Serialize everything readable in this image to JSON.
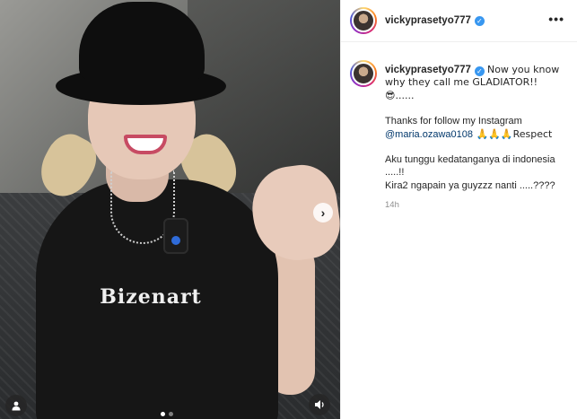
{
  "post": {
    "username": "vickyprasetyo777",
    "verified_icon": "verified-badge-icon",
    "more_icon": "more-options-icon",
    "more_label": "•••",
    "caption": {
      "line1": "Now you know why they call me GLADIATOR!! 😎......",
      "line2_prefix": "Thanks for follow my Instagram",
      "mention": "@maria.ozawa0108",
      "line2_suffix": " 🙏🙏🙏Respect",
      "line3": "Aku tunggu kedatanganya di indonesia .....!!",
      "line4": "Kira2 ngapain ya guyzzz nanti .....????"
    },
    "timestamp": "14h"
  },
  "media": {
    "shirt_text": "Bizenart",
    "carousel": {
      "count": 2,
      "active_index": 0
    },
    "next_icon": "chevron-right-icon",
    "next_label": "›",
    "tags_icon": "user-tag-icon",
    "audio_icon": "speaker-icon"
  },
  "colors": {
    "text": "#262626",
    "mention": "#00376b",
    "verified": "#3897f0",
    "timestamp": "#8e8e8e"
  }
}
